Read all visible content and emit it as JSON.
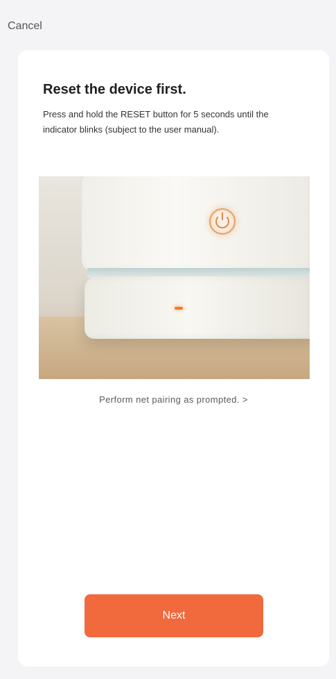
{
  "header": {
    "cancel_label": "Cancel"
  },
  "content": {
    "title": "Reset the device first.",
    "description": "Press and hold the RESET button for 5 seconds until the indicator blinks (subject to the user manual).",
    "image_icons": [
      "power-icon",
      "indicator-light"
    ],
    "pairing_link": "Perform net pairing as prompted. >"
  },
  "footer": {
    "next_label": "Next"
  },
  "colors": {
    "accent": "#f06a3e",
    "background": "#f4f4f6",
    "card": "#ffffff"
  }
}
